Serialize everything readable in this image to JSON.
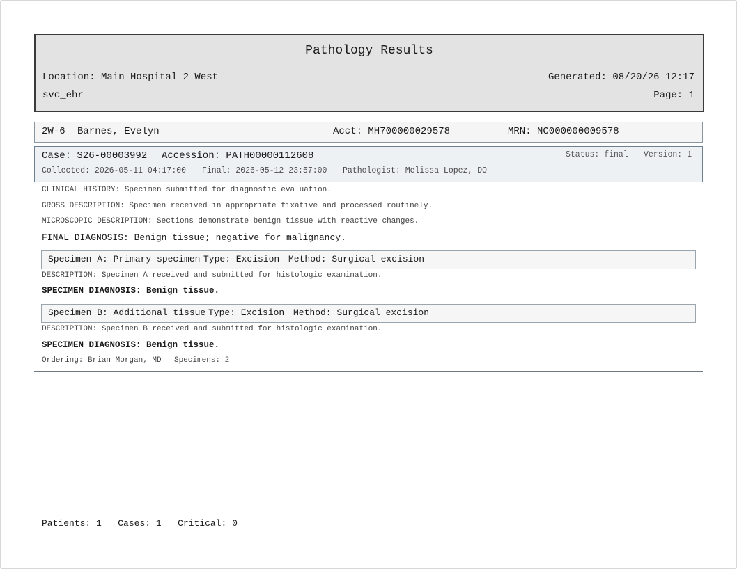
{
  "header": {
    "title": "Pathology Results",
    "location": "Location: Main Hospital 2 West",
    "user": "svc_ehr",
    "generated": "Generated: 08/20/26 12:17",
    "page": "Page: 1"
  },
  "patient": {
    "bed": "2W-6",
    "name": "Barnes, Evelyn",
    "acct": "Acct: MH700000029578",
    "mrn": "MRN: NC000000009578"
  },
  "case": {
    "case_number": "Case: S26-00003992",
    "accession": "Accession: PATH00000112608",
    "status": "Status: final",
    "version": "Version: 1",
    "collected": "Collected: 2026-05-11 04:17:00",
    "final": "Final: 2026-05-12 23:57:00",
    "pathologist": "Pathologist: Melissa Lopez, DO"
  },
  "report": {
    "clinical_history": "CLINICAL HISTORY: Specimen submitted for diagnostic evaluation.",
    "gross_description": "GROSS DESCRIPTION: Specimen received in appropriate fixative and processed routinely.",
    "microscopic_description": "MICROSCOPIC DESCRIPTION: Sections demonstrate benign tissue with reactive changes.",
    "final_diagnosis": "FINAL DIAGNOSIS: Benign tissue; negative for malignancy."
  },
  "specimens": [
    {
      "label": "Specimen A: Primary specimen",
      "type": "Type: Excision",
      "method": "Method: Surgical excision",
      "description": "DESCRIPTION: Specimen A received and submitted for histologic examination.",
      "diagnosis": "SPECIMEN DIAGNOSIS: Benign tissue."
    },
    {
      "label": "Specimen B: Additional tissue",
      "type": "Type: Excision",
      "method": "Method: Surgical excision",
      "description": "DESCRIPTION: Specimen B received and submitted for histologic examination.",
      "diagnosis": "SPECIMEN DIAGNOSIS: Benign tissue."
    }
  ],
  "case_footer": {
    "ordering": "Ordering: Brian Morgan, MD",
    "specimen_count": "Specimens: 2"
  },
  "summary": {
    "patients": "Patients: 1",
    "cases": "Cases: 1",
    "critical": "Critical: 0"
  }
}
